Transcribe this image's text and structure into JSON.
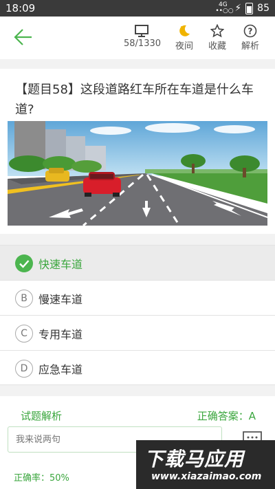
{
  "status": {
    "time": "18:09",
    "network": "4G",
    "battery": "85"
  },
  "header": {
    "tools": [
      {
        "icon": "monitor-icon",
        "label": "58/1330"
      },
      {
        "icon": "moon-icon",
        "label": "夜间"
      },
      {
        "icon": "star-icon",
        "label": "收藏"
      },
      {
        "icon": "help-icon",
        "label": "解析"
      }
    ]
  },
  "question": {
    "text": "【题目58】这段道路红车所在车道是什么车道?"
  },
  "options": [
    {
      "key": "A",
      "label": "快速车道",
      "selected": true
    },
    {
      "key": "B",
      "label": "慢速车道",
      "selected": false
    },
    {
      "key": "C",
      "label": "专用车道",
      "selected": false
    },
    {
      "key": "D",
      "label": "应急车道",
      "selected": false
    }
  ],
  "analysis": {
    "title": "试题解析",
    "answer": "正确答案：A"
  },
  "comment": {
    "placeholder": "我来说两句"
  },
  "stats": {
    "rate": "正确率：50%"
  },
  "watermark": {
    "line1": "下载马应用",
    "line2": "www.xiazaimao.com"
  }
}
